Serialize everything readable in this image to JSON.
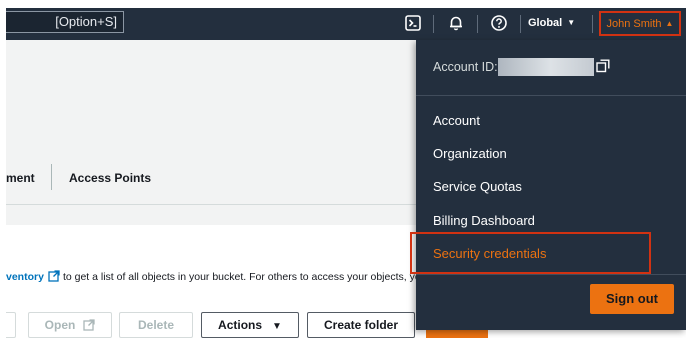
{
  "topnav": {
    "search_hint": "[Option+S]",
    "region_label": "Global",
    "user_label": "John Smith"
  },
  "tabs": {
    "partial_tab": "ment",
    "access_points": "Access Points"
  },
  "objects": {
    "inventory_link": "ventory",
    "info_text": "to get a list of all objects in your bucket. For others to access your objects, yo",
    "open_label": "Open",
    "delete_label": "Delete",
    "actions_label": "Actions",
    "create_folder_label": "Create folder"
  },
  "account_menu": {
    "account_id_label": "Account ID:",
    "items": [
      {
        "label": "Account"
      },
      {
        "label": "Organization"
      },
      {
        "label": "Service Quotas"
      },
      {
        "label": "Billing Dashboard"
      },
      {
        "label": "Security credentials"
      }
    ],
    "sign_out_label": "Sign out"
  },
  "colors": {
    "nav_background": "#232f3e",
    "accent_orange": "#ec7211",
    "highlight_red": "#d13212",
    "link_blue": "#0073bb"
  },
  "icons": [
    "cloudshell-icon",
    "bell-icon",
    "help-icon",
    "copy-icon",
    "external-link-icon"
  ]
}
